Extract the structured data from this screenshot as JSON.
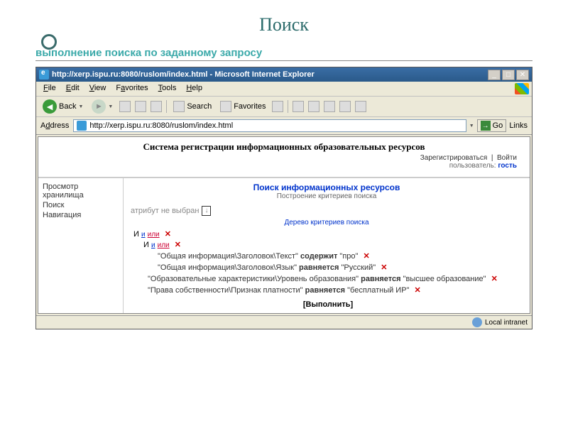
{
  "slide": {
    "title": "Поиск",
    "subtitle": "выполнение поиска по заданному запросу"
  },
  "window": {
    "title": "http://xerp.ispu.ru:8080/ruslom/index.html - Microsoft Internet Explorer",
    "menu": {
      "file": "File",
      "edit": "Edit",
      "view": "View",
      "favorites": "Favorites",
      "tools": "Tools",
      "help": "Help"
    },
    "toolbar": {
      "back": "Back",
      "search": "Search",
      "favorites": "Favorites"
    },
    "address_label": "Address",
    "url": "http://xerp.ispu.ru:8080/ruslom/index.html",
    "go": "Go",
    "links": "Links",
    "status": "Local intranet"
  },
  "page": {
    "header_title": "Система регистрации информационных образовательных ресурсов",
    "register": "Зарегистрироваться",
    "login": "Войти",
    "user_label": "пользователь:",
    "user_value": "гость",
    "sidebar": [
      "Просмотр хранилища",
      "Поиск",
      "Навигация"
    ],
    "search_title": "Поиск информационных ресурсов",
    "search_sub": "Построение критериев поиска",
    "attr_placeholder": "атрибут не выбран",
    "tree_title": "Дерево критериев поиска",
    "op_and": "И",
    "op_and_link": "и",
    "op_or_link": "или",
    "criteria": [
      {
        "path": "\"Общая информация\\Заголовок\\Текст\"",
        "op": "содержит",
        "val": "\"про\""
      },
      {
        "path": "\"Общая информация\\Заголовок\\Язык\"",
        "op": "равняется",
        "val": "\"Русский\""
      },
      {
        "path": "\"Образовательные характеристики\\Уровень образования\"",
        "op": "равняется",
        "val": "\"высшее образование\""
      },
      {
        "path": "\"Права собственности\\Признак платности\"",
        "op": "равняется",
        "val": "\"бесплатный ИР\""
      }
    ],
    "execute": "[Выполнить]"
  }
}
